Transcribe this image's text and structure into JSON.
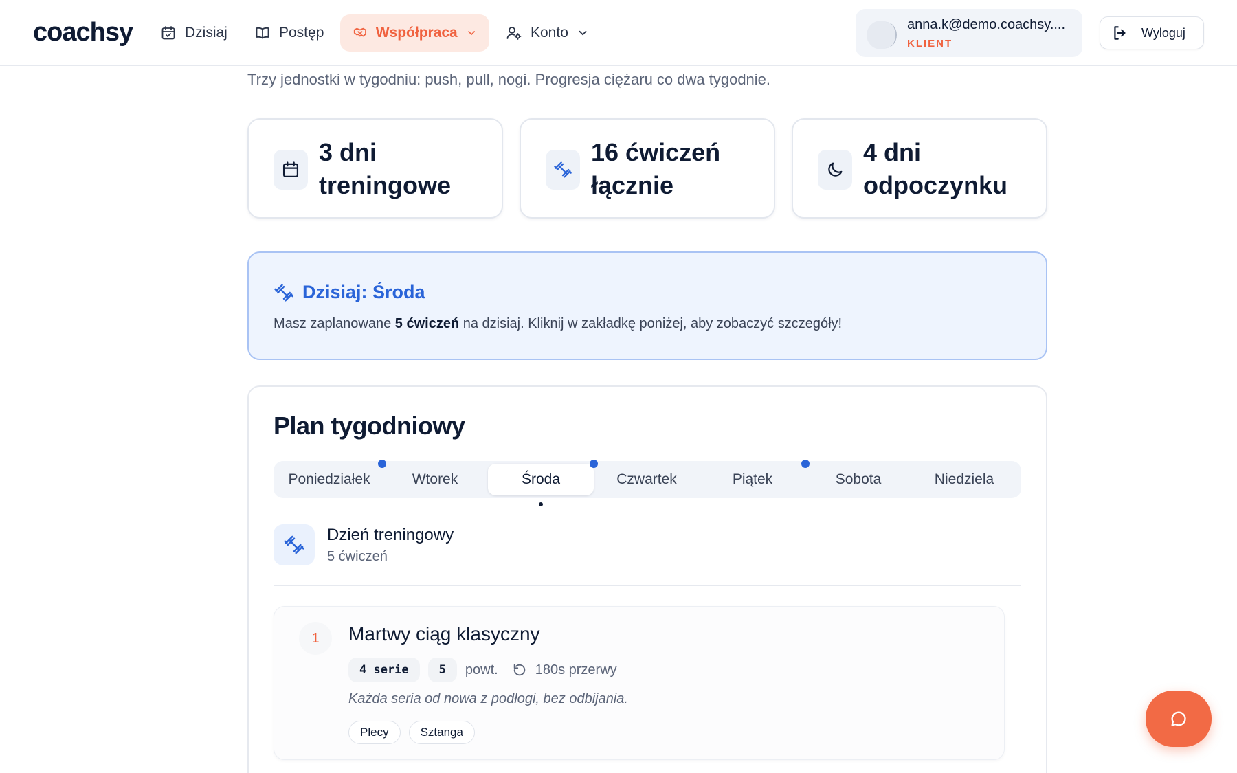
{
  "brand": {
    "logo": "coachsy",
    "accent": "#f0623f",
    "primary": "#2a64d8"
  },
  "nav": {
    "today": {
      "label": "Dzisiaj",
      "icon": "calendar-check-icon"
    },
    "progress": {
      "label": "Postęp",
      "icon": "book-icon"
    },
    "collab": {
      "label": "Współpraca",
      "icon": "handshake-icon"
    },
    "account": {
      "label": "Konto",
      "icon": "user-settings-icon"
    }
  },
  "user": {
    "email": "anna.k@demo.coachsy....",
    "role": "KLIENT",
    "logout_label": "Wyloguj"
  },
  "plan_intro": "Trzy jednostki w tygodniu: push, pull, nogi. Progresja ciężaru co dwa tygodnie.",
  "stats": [
    {
      "text": "3 dni treningowe",
      "icon": "calendar-icon"
    },
    {
      "text": "16 ćwiczeń łącznie",
      "icon": "dumbbell-icon"
    },
    {
      "text": "4 dni odpoczynku",
      "icon": "moon-icon"
    }
  ],
  "today_card": {
    "title": "Dzisiaj: Środa",
    "desc_before": "Masz zaplanowane ",
    "desc_bold": "5 ćwiczeń",
    "desc_after": " na dzisiaj. Kliknij w zakładkę poniżej, aby zobaczyć szczegóły!"
  },
  "weekly": {
    "title": "Plan tygodniowy",
    "tabs": [
      {
        "label": "Poniedziałek",
        "training": true
      },
      {
        "label": "Wtorek",
        "training": false
      },
      {
        "label": "Środa",
        "training": true,
        "active": true
      },
      {
        "label": "Czwartek",
        "training": false
      },
      {
        "label": "Piątek",
        "training": true
      },
      {
        "label": "Sobota",
        "training": false
      },
      {
        "label": "Niedziela",
        "training": false
      }
    ],
    "day_title": "Dzień treningowy",
    "day_sub": "5 ćwiczeń"
  },
  "exercise": {
    "number": "1",
    "name": "Martwy ciąg klasyczny",
    "sets": "4 serie",
    "reps": "5",
    "reps_unit": "powt.",
    "rest": "180s przerwy",
    "note": "Każda seria od nowa z podłogi, bez odbijania.",
    "tags": [
      "Plecy",
      "Sztanga"
    ]
  },
  "chat": {
    "icon": "chat-bubble-icon"
  }
}
